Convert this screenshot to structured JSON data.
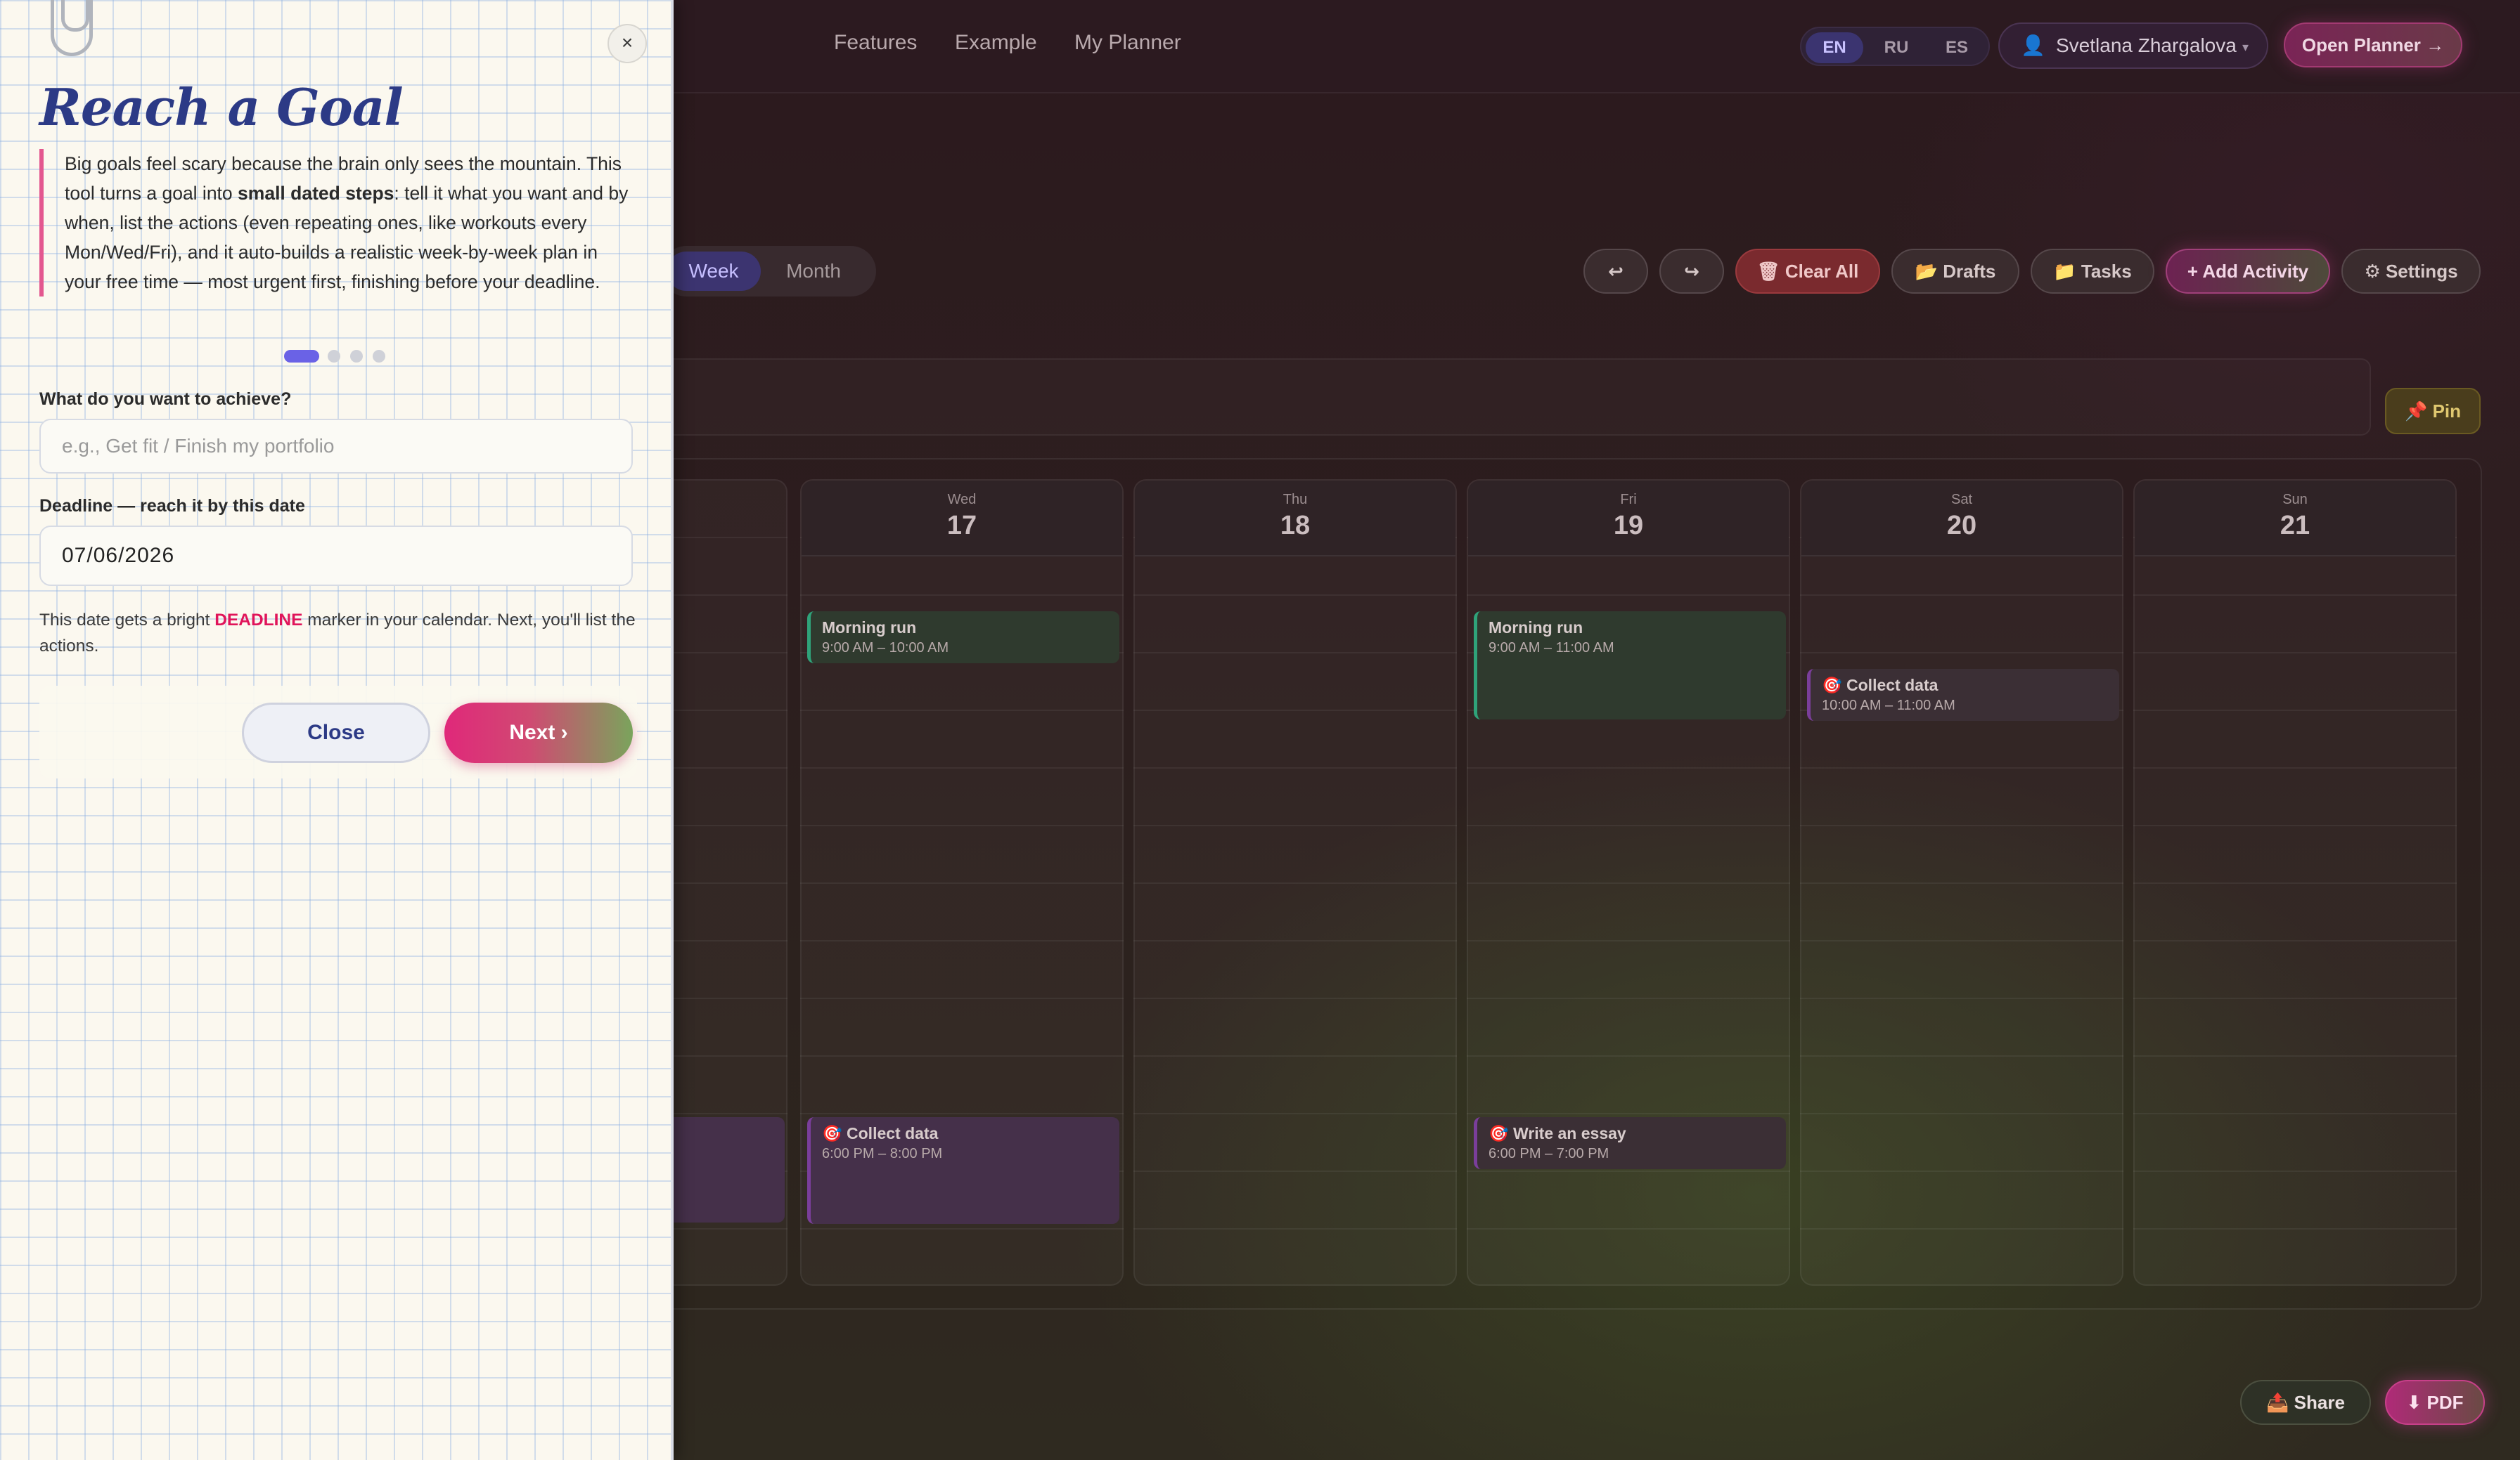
{
  "nav": {
    "links": [
      "Features",
      "Example",
      "My Planner"
    ],
    "languages": [
      "EN",
      "RU",
      "ES"
    ],
    "active_language": "EN",
    "user_name": "Svetlana Zhargalova",
    "open_planner": "Open Planner →"
  },
  "view": {
    "tabs": [
      "Week",
      "Month"
    ],
    "active_tab": "Week"
  },
  "toolbar": {
    "undo": "↩",
    "redo": "↪",
    "clear_all": "🗑 Clear All",
    "drafts": "📂 Drafts",
    "tasks": "📁 Tasks",
    "add_activity": "+ Add Activity",
    "settings": "⚙ Settings",
    "pin": "📌 Pin"
  },
  "calendar": {
    "days": [
      {
        "name": "Wed",
        "num": "17"
      },
      {
        "name": "Thu",
        "num": "18"
      },
      {
        "name": "Fri",
        "num": "19"
      },
      {
        "name": "Sat",
        "num": "20"
      },
      {
        "name": "Sun",
        "num": "21"
      }
    ],
    "events": [
      {
        "title": "Morning run",
        "time": "9:00 AM – 10:00 AM"
      },
      {
        "title": "🎯 Collect data",
        "time": "6:00 PM – 8:00 PM"
      },
      {
        "title": "Morning run",
        "time": "9:00 AM – 11:00 AM"
      },
      {
        "title": "🎯 Write an essay",
        "time": "6:00 PM – 7:00 PM"
      },
      {
        "title": "🎯 Collect data",
        "time": "10:00 AM – 11:00 AM"
      }
    ]
  },
  "bottom": {
    "share": "📤 Share",
    "pdf": "⬇ PDF"
  },
  "wizard": {
    "close_x": "×",
    "title": "Reach a Goal",
    "intro_1": "Big goals feel scary because the brain only sees the mountain. This tool turns a goal into ",
    "intro_bold": "small dated steps",
    "intro_2": ": tell it what you want and by when, list the actions (even repeating ones, like workouts every Mon/Wed/Fri), and it auto-builds a realistic week-by-week plan in your free time — most urgent first, finishing before your deadline.",
    "step_current": 1,
    "step_total": 4,
    "goal_label": "What do you want to achieve?",
    "goal_placeholder": "e.g., Get fit / Finish my portfolio",
    "goal_value": "",
    "deadline_label": "Deadline — reach it by this date",
    "deadline_value": "07/06/2026",
    "hint_1": "This date gets a bright ",
    "hint_deadline": "DEADLINE",
    "hint_2": " marker in your calendar. Next, you'll list the actions.",
    "close_button": "Close",
    "next_button": "Next ›"
  },
  "colors": {
    "accent_pink": "#e0287a",
    "title_blue": "#2c3a86",
    "deadline_red": "#e0145a",
    "event_green": "#2fa37a",
    "event_purple": "#7a3e9a"
  }
}
